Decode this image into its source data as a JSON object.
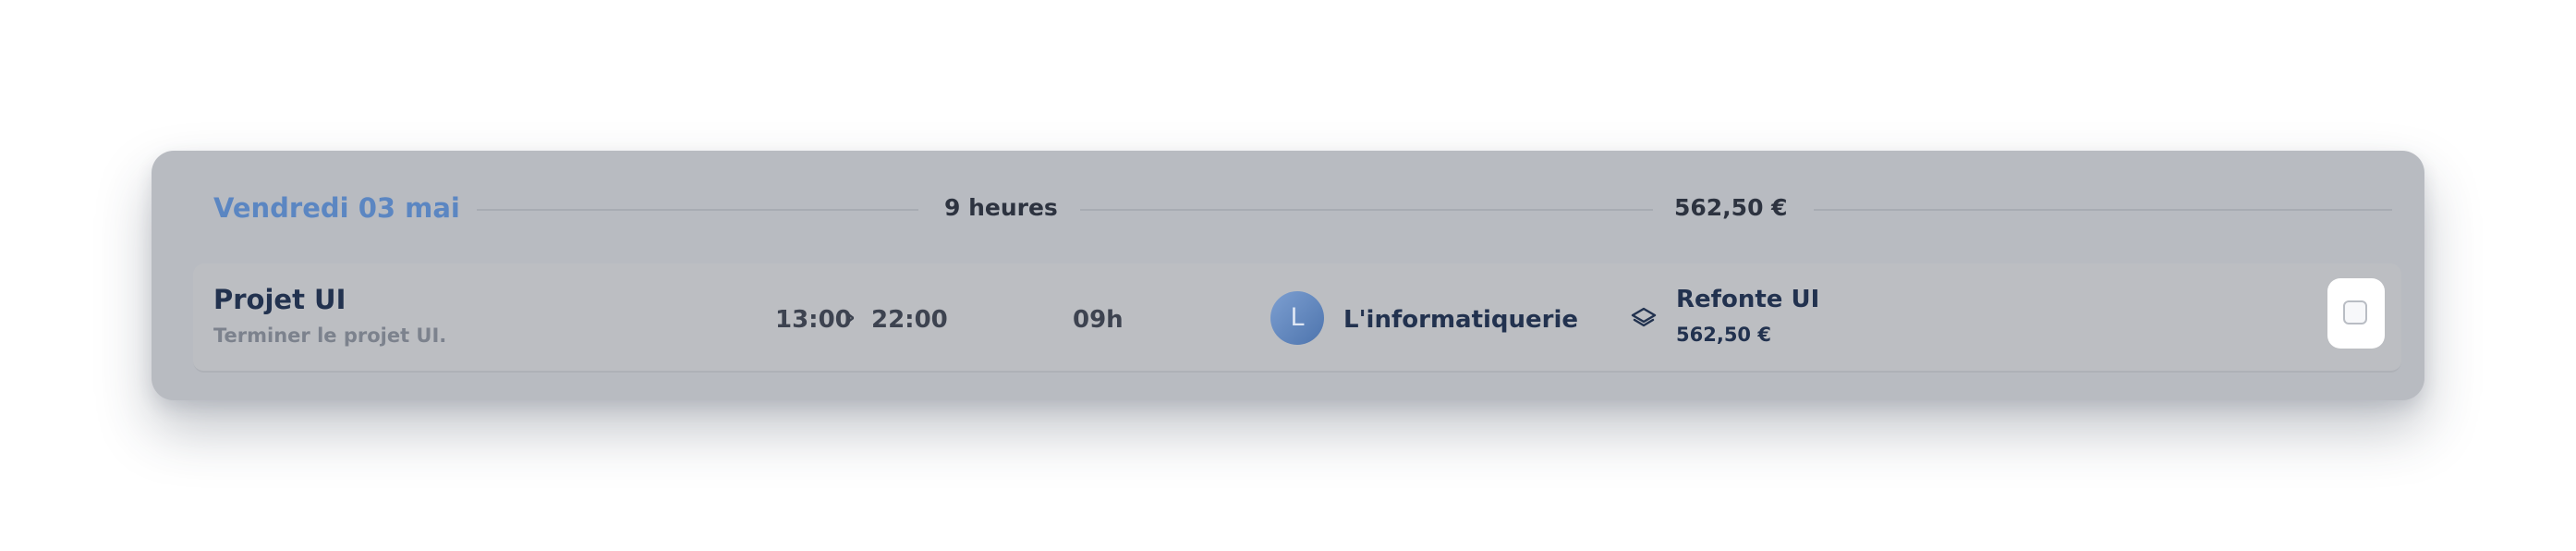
{
  "day": {
    "date_label": "Vendredi 03 mai",
    "hours_label": "9 heures",
    "total_label": "562,50 €"
  },
  "entry": {
    "title": "Projet UI",
    "description": "Terminer le projet UI.",
    "start_time": "13:00",
    "arrow": "›",
    "end_time": "22:00",
    "duration": "09h",
    "client_initial": "L",
    "client_name": "L'informatiquerie",
    "project_name": "Refonte UI",
    "amount": "562,50 €",
    "project_icon": "layers-icon",
    "selected": false
  },
  "colors": {
    "accent": "#5b86c2",
    "text_dark": "#22324f",
    "card_bg": "#b8bbc1"
  }
}
